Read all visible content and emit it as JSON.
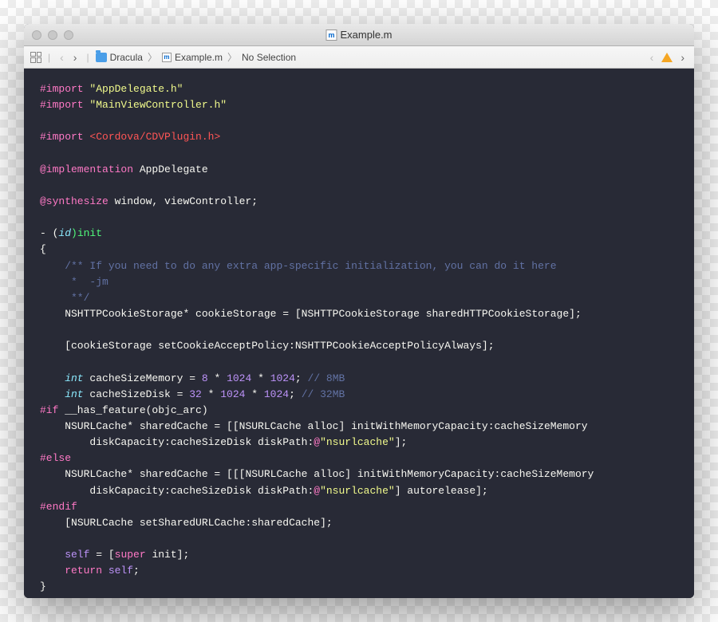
{
  "window": {
    "title": "Example.m"
  },
  "breadcrumb": {
    "project": "Dracula",
    "file": "Example.m",
    "selection": "No Selection"
  },
  "code": {
    "line1_kw": "#import",
    "line1_str": "\"AppDelegate.h\"",
    "line2_kw": "#import",
    "line2_str": "\"MainViewController.h\"",
    "line4_kw": "#import",
    "line4_str": "<Cordova/CDVPlugin.h>",
    "line6_kw": "@implementation",
    "line6_name": " AppDelegate",
    "line8_kw": "@synthesize",
    "line8_rest": " window, viewController;",
    "line10_dash": "- (",
    "line10_type": "id",
    "line10_name": ")init",
    "line11": "{",
    "line12_c": "    /** If you need to do any extra app-specific initialization, you can do it here",
    "line13_c": "     *  -jm",
    "line14_c": "     **/",
    "line15_a": "    NSHTTPCookieStorage",
    "line15_b": "* cookieStorage = [",
    "line15_c": "NSHTTPCookieStorage",
    "line15_d": " sharedHTTPCookieStorage];",
    "line17_a": "    [cookieStorage ",
    "line17_b": "setCookieAcceptPolicy:",
    "line17_c": "NSHTTPCookieAcceptPolicyAlways];",
    "line19_a": "    int",
    "line19_b": " cacheSizeMemory = ",
    "line19_c": "8",
    "line19_d": " * ",
    "line19_e": "1024",
    "line19_f": " * ",
    "line19_g": "1024",
    "line19_h": "; ",
    "line19_i": "// 8MB",
    "line20_a": "    int",
    "line20_b": " cacheSizeDisk = ",
    "line20_c": "32",
    "line20_d": " * ",
    "line20_e": "1024",
    "line20_f": " * ",
    "line20_g": "1024",
    "line20_h": "; ",
    "line20_i": "// 32MB",
    "line21_kw": "#if",
    "line21_rest": " __has_feature(objc_arc)",
    "line22_a": "    NSURLCache",
    "line22_b": "* sharedCache = [[",
    "line22_c": "NSURLCache",
    "line22_d": " alloc] ",
    "line22_e": "initWithMemoryCapacity:",
    "line22_f": "cacheSizeMemory",
    "line23_a": "        diskCapacity:",
    "line23_b": "cacheSizeDisk ",
    "line23_c": "diskPath:",
    "line23_d": "@",
    "line23_e": "\"nsurlcache\"",
    "line23_f": "];",
    "line24_kw": "#else",
    "line25_a": "    NSURLCache",
    "line25_b": "* sharedCache = [[[",
    "line25_c": "NSURLCache",
    "line25_d": " alloc] ",
    "line25_e": "initWithMemoryCapacity:",
    "line25_f": "cacheSizeMemory",
    "line26_a": "        diskCapacity:",
    "line26_b": "cacheSizeDisk ",
    "line26_c": "diskPath:",
    "line26_d": "@",
    "line26_e": "\"nsurlcache\"",
    "line26_f": "] autorelease];",
    "line27_kw": "#endif",
    "line28_a": "    [",
    "line28_b": "NSURLCache",
    "line28_c": " setSharedURLCache:sharedCache];",
    "line30_a": "    self",
    "line30_b": " = [",
    "line30_c": "super",
    "line30_d": " init];",
    "line31_a": "    return",
    "line31_b": " ",
    "line31_c": "self",
    "line31_d": ";",
    "line32": "}"
  }
}
